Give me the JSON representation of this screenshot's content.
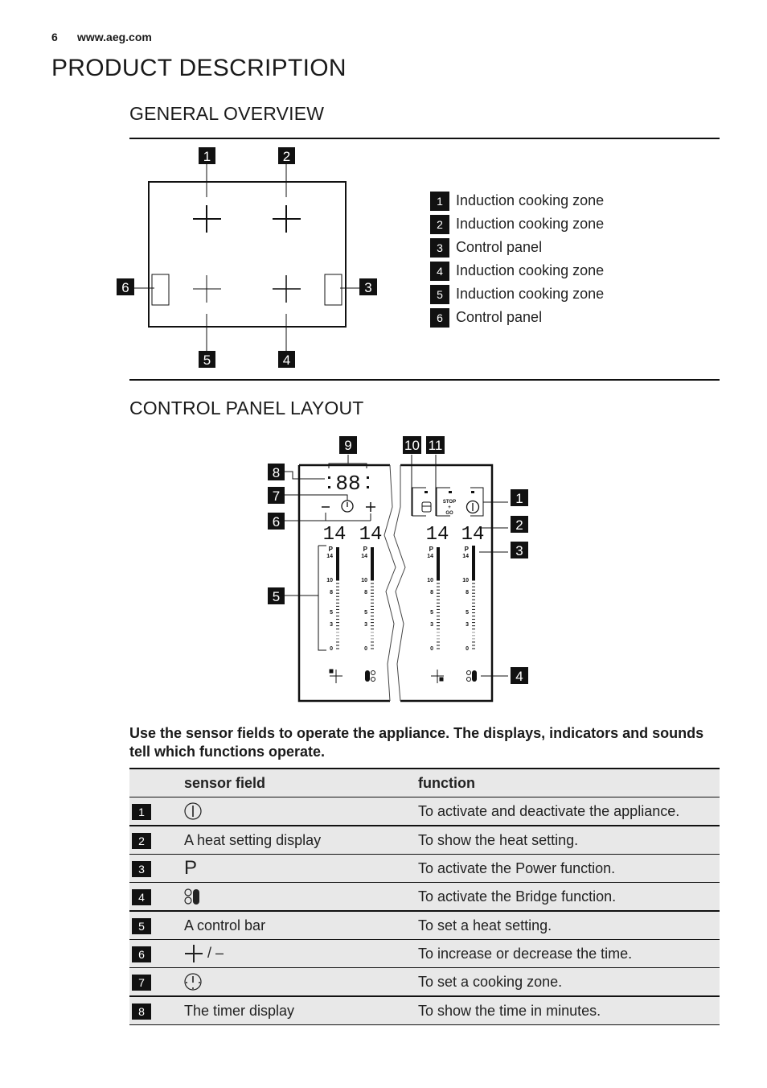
{
  "header": {
    "page_number": "6",
    "website": "www.aeg.com"
  },
  "title": "PRODUCT DESCRIPTION",
  "general_overview": {
    "heading": "GENERAL OVERVIEW",
    "callouts": [
      "1",
      "2",
      "3",
      "4",
      "5",
      "6"
    ],
    "legend": [
      {
        "num": "1",
        "label": "Induction cooking zone"
      },
      {
        "num": "2",
        "label": "Induction cooking zone"
      },
      {
        "num": "3",
        "label": "Control panel"
      },
      {
        "num": "4",
        "label": "Induction cooking zone"
      },
      {
        "num": "5",
        "label": "Induction cooking zone"
      },
      {
        "num": "6",
        "label": "Control panel"
      }
    ]
  },
  "control_panel_layout": {
    "heading": "CONTROL PANEL LAYOUT",
    "callouts": {
      "c1": "1",
      "c2": "2",
      "c3": "3",
      "c4": "4",
      "c5": "5",
      "c6": "6",
      "c7": "7",
      "c8": "8",
      "c9": "9",
      "c10": "10",
      "c11": "11"
    },
    "timer_display": "88",
    "heat_displays": [
      "14",
      "14",
      "14",
      "14"
    ],
    "stop_go_label": [
      "STOP",
      "+",
      "GO"
    ],
    "scale_labels": [
      "P",
      "14",
      "10",
      "8",
      "5",
      "3",
      "0"
    ]
  },
  "intro": "Use the sensor fields to operate the appliance. The displays, indicators and sounds tell which functions operate.",
  "table": {
    "headers": {
      "sensor_field": "sensor field",
      "function": "function"
    },
    "rows": [
      {
        "num": "1",
        "icon": "power-icon",
        "sensor": "",
        "function": "To activate and deactivate the appliance."
      },
      {
        "num": "2",
        "icon": "",
        "sensor": "A heat setting display",
        "function": "To show the heat setting."
      },
      {
        "num": "3",
        "icon": "power-function-p-icon",
        "sensor": "P",
        "function": "To activate the Power function."
      },
      {
        "num": "4",
        "icon": "bridge-icon",
        "sensor": "",
        "function": "To activate the Bridge function."
      },
      {
        "num": "5",
        "icon": "",
        "sensor": "A control bar",
        "function": "To set a heat setting."
      },
      {
        "num": "6",
        "icon": "plus-minus-icon",
        "sensor": "/ –",
        "function": "To increase or decrease the time."
      },
      {
        "num": "7",
        "icon": "zone-select-icon",
        "sensor": "",
        "function": "To set a cooking zone."
      },
      {
        "num": "8",
        "icon": "",
        "sensor": "The timer display",
        "function": "To show the time in minutes."
      }
    ]
  }
}
